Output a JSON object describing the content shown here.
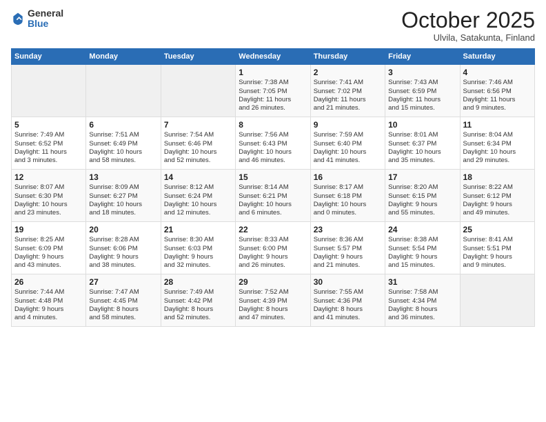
{
  "logo": {
    "general": "General",
    "blue": "Blue"
  },
  "header": {
    "month": "October 2025",
    "location": "Ulvila, Satakunta, Finland"
  },
  "days_of_week": [
    "Sunday",
    "Monday",
    "Tuesday",
    "Wednesday",
    "Thursday",
    "Friday",
    "Saturday"
  ],
  "weeks": [
    [
      {
        "day": "",
        "content": ""
      },
      {
        "day": "",
        "content": ""
      },
      {
        "day": "",
        "content": ""
      },
      {
        "day": "1",
        "content": "Sunrise: 7:38 AM\nSunset: 7:05 PM\nDaylight: 11 hours\nand 26 minutes."
      },
      {
        "day": "2",
        "content": "Sunrise: 7:41 AM\nSunset: 7:02 PM\nDaylight: 11 hours\nand 21 minutes."
      },
      {
        "day": "3",
        "content": "Sunrise: 7:43 AM\nSunset: 6:59 PM\nDaylight: 11 hours\nand 15 minutes."
      },
      {
        "day": "4",
        "content": "Sunrise: 7:46 AM\nSunset: 6:56 PM\nDaylight: 11 hours\nand 9 minutes."
      }
    ],
    [
      {
        "day": "5",
        "content": "Sunrise: 7:49 AM\nSunset: 6:52 PM\nDaylight: 11 hours\nand 3 minutes."
      },
      {
        "day": "6",
        "content": "Sunrise: 7:51 AM\nSunset: 6:49 PM\nDaylight: 10 hours\nand 58 minutes."
      },
      {
        "day": "7",
        "content": "Sunrise: 7:54 AM\nSunset: 6:46 PM\nDaylight: 10 hours\nand 52 minutes."
      },
      {
        "day": "8",
        "content": "Sunrise: 7:56 AM\nSunset: 6:43 PM\nDaylight: 10 hours\nand 46 minutes."
      },
      {
        "day": "9",
        "content": "Sunrise: 7:59 AM\nSunset: 6:40 PM\nDaylight: 10 hours\nand 41 minutes."
      },
      {
        "day": "10",
        "content": "Sunrise: 8:01 AM\nSunset: 6:37 PM\nDaylight: 10 hours\nand 35 minutes."
      },
      {
        "day": "11",
        "content": "Sunrise: 8:04 AM\nSunset: 6:34 PM\nDaylight: 10 hours\nand 29 minutes."
      }
    ],
    [
      {
        "day": "12",
        "content": "Sunrise: 8:07 AM\nSunset: 6:30 PM\nDaylight: 10 hours\nand 23 minutes."
      },
      {
        "day": "13",
        "content": "Sunrise: 8:09 AM\nSunset: 6:27 PM\nDaylight: 10 hours\nand 18 minutes."
      },
      {
        "day": "14",
        "content": "Sunrise: 8:12 AM\nSunset: 6:24 PM\nDaylight: 10 hours\nand 12 minutes."
      },
      {
        "day": "15",
        "content": "Sunrise: 8:14 AM\nSunset: 6:21 PM\nDaylight: 10 hours\nand 6 minutes."
      },
      {
        "day": "16",
        "content": "Sunrise: 8:17 AM\nSunset: 6:18 PM\nDaylight: 10 hours\nand 0 minutes."
      },
      {
        "day": "17",
        "content": "Sunrise: 8:20 AM\nSunset: 6:15 PM\nDaylight: 9 hours\nand 55 minutes."
      },
      {
        "day": "18",
        "content": "Sunrise: 8:22 AM\nSunset: 6:12 PM\nDaylight: 9 hours\nand 49 minutes."
      }
    ],
    [
      {
        "day": "19",
        "content": "Sunrise: 8:25 AM\nSunset: 6:09 PM\nDaylight: 9 hours\nand 43 minutes."
      },
      {
        "day": "20",
        "content": "Sunrise: 8:28 AM\nSunset: 6:06 PM\nDaylight: 9 hours\nand 38 minutes."
      },
      {
        "day": "21",
        "content": "Sunrise: 8:30 AM\nSunset: 6:03 PM\nDaylight: 9 hours\nand 32 minutes."
      },
      {
        "day": "22",
        "content": "Sunrise: 8:33 AM\nSunset: 6:00 PM\nDaylight: 9 hours\nand 26 minutes."
      },
      {
        "day": "23",
        "content": "Sunrise: 8:36 AM\nSunset: 5:57 PM\nDaylight: 9 hours\nand 21 minutes."
      },
      {
        "day": "24",
        "content": "Sunrise: 8:38 AM\nSunset: 5:54 PM\nDaylight: 9 hours\nand 15 minutes."
      },
      {
        "day": "25",
        "content": "Sunrise: 8:41 AM\nSunset: 5:51 PM\nDaylight: 9 hours\nand 9 minutes."
      }
    ],
    [
      {
        "day": "26",
        "content": "Sunrise: 7:44 AM\nSunset: 4:48 PM\nDaylight: 9 hours\nand 4 minutes."
      },
      {
        "day": "27",
        "content": "Sunrise: 7:47 AM\nSunset: 4:45 PM\nDaylight: 8 hours\nand 58 minutes."
      },
      {
        "day": "28",
        "content": "Sunrise: 7:49 AM\nSunset: 4:42 PM\nDaylight: 8 hours\nand 52 minutes."
      },
      {
        "day": "29",
        "content": "Sunrise: 7:52 AM\nSunset: 4:39 PM\nDaylight: 8 hours\nand 47 minutes."
      },
      {
        "day": "30",
        "content": "Sunrise: 7:55 AM\nSunset: 4:36 PM\nDaylight: 8 hours\nand 41 minutes."
      },
      {
        "day": "31",
        "content": "Sunrise: 7:58 AM\nSunset: 4:34 PM\nDaylight: 8 hours\nand 36 minutes."
      },
      {
        "day": "",
        "content": ""
      }
    ]
  ]
}
